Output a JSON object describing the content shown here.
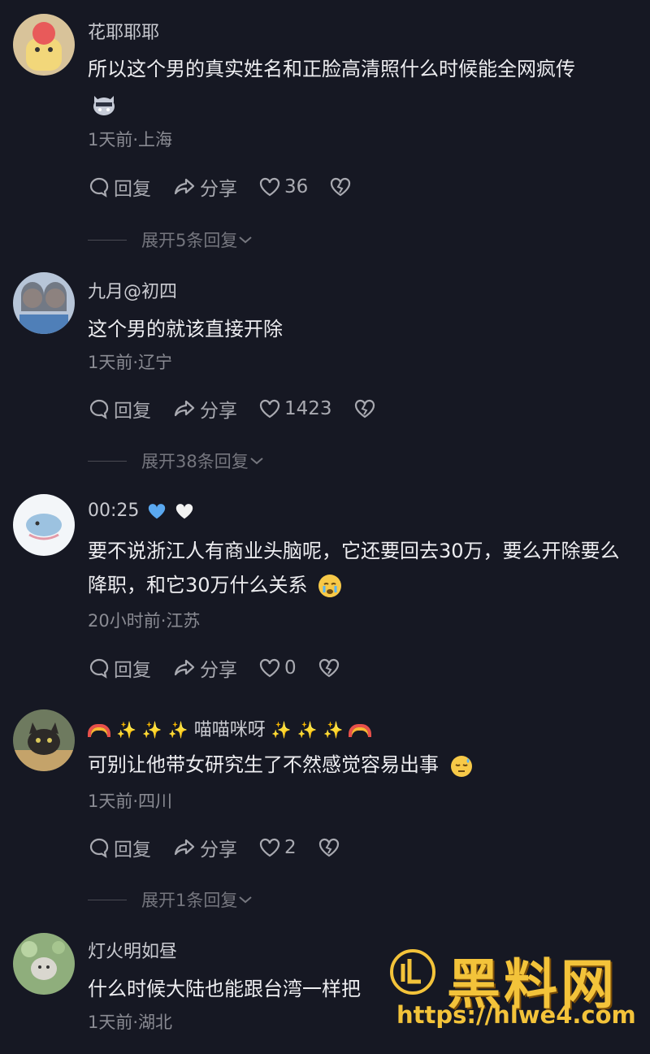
{
  "comments": [
    {
      "username": "花耶耶耶",
      "text": "所以这个男的真实姓名和正脸高清照什么时候能全网疯传",
      "meta": "1天前·上海",
      "reply_label": "回复",
      "share_label": "分享",
      "likes": "36",
      "expand_label": "展开5条回复",
      "avatar_color": "#c9a96b"
    },
    {
      "username": "九月@初四",
      "text": "这个男的就该直接开除",
      "meta": "1天前·辽宁",
      "reply_label": "回复",
      "share_label": "分享",
      "likes": "1423",
      "expand_label": "展开38条回复",
      "avatar_color": "#8aa3c4"
    },
    {
      "username": "00:25",
      "text": "要不说浙江人有商业头脑呢，它还要回去30万，要么开除要么降职，和它30万什么关系",
      "meta": "20小时前·江苏",
      "reply_label": "回复",
      "share_label": "分享",
      "likes": "0",
      "avatar_color": "#e6eef5"
    },
    {
      "username": "喵喵咪呀",
      "text": "可别让他带女研究生了不然感觉容易出事",
      "meta": "1天前·四川",
      "reply_label": "回复",
      "share_label": "分享",
      "likes": "2",
      "expand_label": "展开1条回复",
      "avatar_color": "#5f6b55"
    },
    {
      "username": "灯火明如昼",
      "text": "什么时候大陆也能跟台湾一样把",
      "meta": "1天前·湖北",
      "avatar_color": "#7c9a6a"
    }
  ],
  "watermark": {
    "title": "黑料网",
    "url": "https://hlwe4.com"
  },
  "colors": {
    "background": "#161823",
    "watermark": "#f3c33a",
    "heart_blue": "#5aa8f0"
  }
}
